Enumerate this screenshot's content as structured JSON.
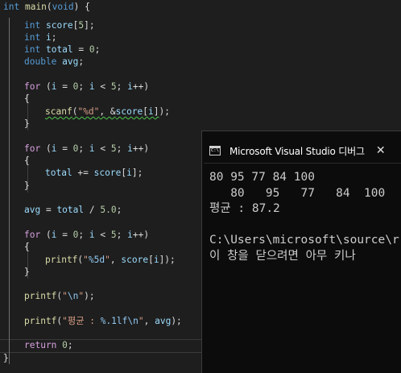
{
  "editor": {
    "lines": [
      [
        [
          "kw",
          "int"
        ],
        [
          "",
          " "
        ],
        [
          "fn",
          "main"
        ],
        [
          "",
          "("
        ],
        [
          "kw",
          "void"
        ],
        [
          "",
          ") {"
        ]
      ],
      [
        [
          "kw",
          "int"
        ],
        [
          "",
          " "
        ],
        [
          "var",
          "score"
        ],
        [
          "",
          "["
        ],
        [
          "num",
          "5"
        ],
        [
          "",
          "];"
        ]
      ],
      [
        [
          "kw",
          "int"
        ],
        [
          "",
          " "
        ],
        [
          "var",
          "i"
        ],
        [
          "",
          ";"
        ]
      ],
      [
        [
          "kw",
          "int"
        ],
        [
          "",
          " "
        ],
        [
          "var",
          "total"
        ],
        [
          "",
          " = "
        ],
        [
          "num",
          "0"
        ],
        [
          "",
          ";"
        ]
      ],
      [
        [
          "kw",
          "double"
        ],
        [
          "",
          " "
        ],
        [
          "var",
          "avg"
        ],
        [
          "",
          ";"
        ]
      ],
      [
        [
          "ctl",
          "for"
        ],
        [
          "",
          " ("
        ],
        [
          "var",
          "i"
        ],
        [
          "",
          " = "
        ],
        [
          "num",
          "0"
        ],
        [
          "",
          "; "
        ],
        [
          "var",
          "i"
        ],
        [
          "",
          " < "
        ],
        [
          "num",
          "5"
        ],
        [
          "",
          "; "
        ],
        [
          "var",
          "i"
        ],
        [
          "",
          "++)"
        ]
      ],
      [
        [
          "",
          "{"
        ]
      ],
      [
        [
          "fnsq",
          "scanf"
        ],
        [
          "sq",
          "("
        ],
        [
          "strsq",
          "\"%d\""
        ],
        [
          "sq",
          ", &"
        ],
        [
          "varsq",
          "score"
        ],
        [
          "sq",
          "["
        ],
        [
          "varsq",
          "i"
        ],
        [
          "sq",
          "]"
        ],
        [
          "",
          ");"
        ]
      ],
      [
        [
          "",
          "}"
        ]
      ],
      [
        [
          "ctl",
          "for"
        ],
        [
          "",
          " ("
        ],
        [
          "var",
          "i"
        ],
        [
          "",
          " = "
        ],
        [
          "num",
          "0"
        ],
        [
          "",
          "; "
        ],
        [
          "var",
          "i"
        ],
        [
          "",
          " < "
        ],
        [
          "num",
          "5"
        ],
        [
          "",
          "; "
        ],
        [
          "var",
          "i"
        ],
        [
          "",
          "++)"
        ]
      ],
      [
        [
          "",
          "{"
        ]
      ],
      [
        [
          "var",
          "total"
        ],
        [
          "",
          " += "
        ],
        [
          "var",
          "score"
        ],
        [
          "",
          "["
        ],
        [
          "var",
          "i"
        ],
        [
          "",
          "];"
        ]
      ],
      [
        [
          "",
          "}"
        ]
      ],
      [
        [
          "var",
          "avg"
        ],
        [
          "",
          " = "
        ],
        [
          "var",
          "total"
        ],
        [
          "",
          " / "
        ],
        [
          "num",
          "5.0"
        ],
        [
          "",
          ";"
        ]
      ],
      [
        [
          "ctl",
          "for"
        ],
        [
          "",
          " ("
        ],
        [
          "var",
          "i"
        ],
        [
          "",
          " = "
        ],
        [
          "num",
          "0"
        ],
        [
          "",
          "; "
        ],
        [
          "var",
          "i"
        ],
        [
          "",
          " < "
        ],
        [
          "num",
          "5"
        ],
        [
          "",
          "; "
        ],
        [
          "var",
          "i"
        ],
        [
          "",
          "++)"
        ]
      ],
      [
        [
          "",
          "{"
        ]
      ],
      [
        [
          "fn",
          "printf"
        ],
        [
          "",
          "("
        ],
        [
          "str",
          "\""
        ],
        [
          "fmt",
          "%5d"
        ],
        [
          "str",
          "\""
        ],
        [
          "",
          ", "
        ],
        [
          "var",
          "score"
        ],
        [
          "",
          "["
        ],
        [
          "var",
          "i"
        ],
        [
          "",
          "]);"
        ]
      ],
      [
        [
          "",
          "}"
        ]
      ],
      [
        [
          "fn",
          "printf"
        ],
        [
          "",
          "("
        ],
        [
          "str",
          "\""
        ],
        [
          "fmt",
          "\\n"
        ],
        [
          "str",
          "\""
        ],
        [
          "",
          ");"
        ]
      ],
      [
        [
          "fn",
          "printf"
        ],
        [
          "",
          "("
        ],
        [
          "str",
          "\"평균 : "
        ],
        [
          "fmt",
          "%.1lf\\n"
        ],
        [
          "str",
          "\""
        ],
        [
          "",
          ", "
        ],
        [
          "var",
          "avg"
        ],
        [
          "",
          ");"
        ]
      ],
      [
        [
          "ctl",
          "return"
        ],
        [
          "",
          " "
        ],
        [
          "num",
          "0"
        ],
        [
          "",
          ";"
        ]
      ],
      [
        [
          "",
          "}"
        ]
      ]
    ]
  },
  "console": {
    "tab_title": "Microsoft Visual Studio 디버그",
    "tab_close": "✕",
    "icon_text": "C:\\",
    "lines": [
      "80 95 77 84 100",
      "   80   95   77   84  100",
      "평균 : 87.2",
      "",
      "C:\\Users\\microsoft\\source\\r",
      "이 창을 닫으려면 아무 키나"
    ]
  }
}
